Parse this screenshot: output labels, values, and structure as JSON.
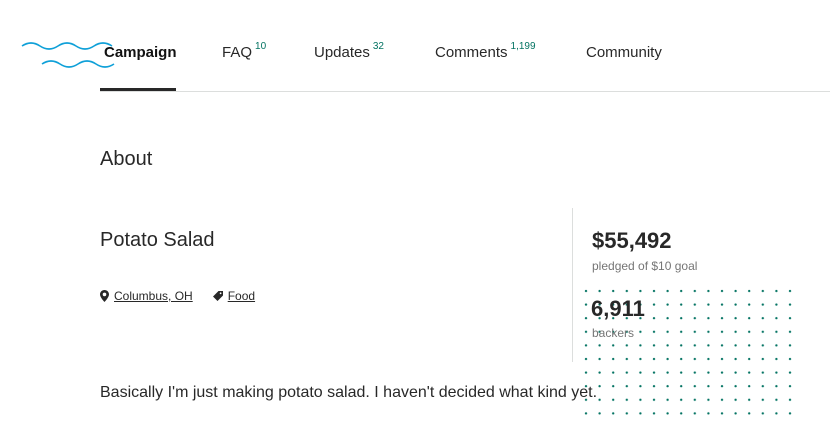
{
  "nav": {
    "tabs": [
      {
        "label": "Campaign",
        "count": ""
      },
      {
        "label": "FAQ",
        "count": "10"
      },
      {
        "label": "Updates",
        "count": "32"
      },
      {
        "label": "Comments",
        "count": "1,199"
      },
      {
        "label": "Community",
        "count": ""
      }
    ],
    "active_tab": "Campaign"
  },
  "main": {
    "about_heading": "About",
    "project_title": "Potato Salad",
    "location": {
      "label": "Columbus, OH",
      "icon": "map-pin-icon"
    },
    "category": {
      "label": "Food",
      "icon": "tag-icon"
    },
    "description": "Basically I'm just making potato salad. I haven't decided what kind yet."
  },
  "stats": {
    "pledged": "$55,492",
    "pledged_caption": "pledged of $10 goal",
    "backers": "6,911",
    "backers_caption": "backers"
  },
  "colors": {
    "accent": "#037362",
    "wave": "#0fa0d8",
    "text": "#282828",
    "muted": "#757575",
    "rule": "#dcdedd"
  }
}
